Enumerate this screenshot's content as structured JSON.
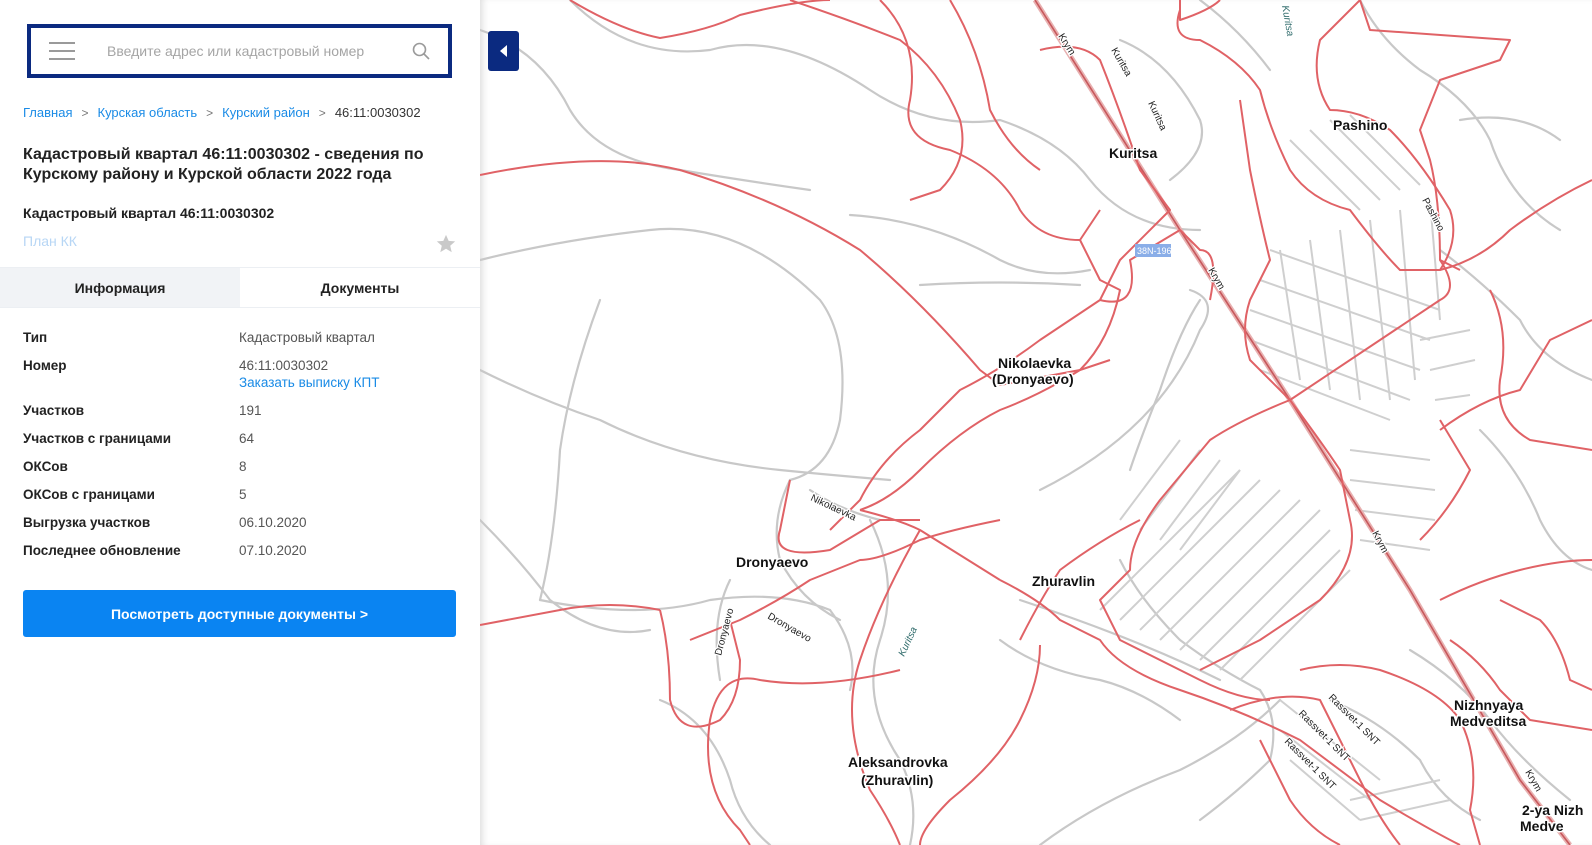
{
  "search": {
    "placeholder": "Введите адрес или кадастровый номер",
    "value": ""
  },
  "breadcrumb": {
    "items": [
      "Главная",
      "Курская область",
      "Курский район"
    ],
    "current": "46:11:0030302"
  },
  "page_title": "Кадастровый квартал 46:11:0030302 - сведения по Курскому району и Курской области 2022 года",
  "sub_title": "Кадастровый квартал 46:11:0030302",
  "plan_link": "План КК",
  "tabs": [
    "Информация",
    "Документы"
  ],
  "info": {
    "rows": [
      {
        "key": "Тип",
        "value": "Кадастровый квартал"
      },
      {
        "key": "Номер",
        "value": "46:11:0030302",
        "link": "Заказать выписку КПТ"
      },
      {
        "key": "Участков",
        "value": "191"
      },
      {
        "key": "Участков с границами",
        "value": "64"
      },
      {
        "key": "ОКСов",
        "value": "8"
      },
      {
        "key": "ОКСов с границами",
        "value": "5"
      },
      {
        "key": "Выгрузка участков",
        "value": "06.10.2020"
      },
      {
        "key": "Последнее обновление",
        "value": "07.10.2020"
      }
    ]
  },
  "docs_button": "Посмотреть доступные документы >",
  "map": {
    "places": [
      "Pashino",
      "Kuritsa",
      "Nikolaevka",
      "(Dronyaevo)",
      "Dronyaevo",
      "Zhuravlin",
      "Aleksandrovka",
      "(Zhuravlin)",
      "Nizhnyaya",
      "Medveditsa",
      "2-ya Nizh",
      "Medve"
    ],
    "streets": [
      "Krym",
      "Kuritsa",
      "Kuritsa",
      "Pashino",
      "Krym",
      "Nikolaevka",
      "Dronyaevo",
      "Dronyaevo",
      "Krym",
      "Rassvet-1 SNT",
      "Rassvet-1 SNT",
      "Rassvet-1 SNT",
      "Krym"
    ],
    "water": [
      "Kuritsa",
      "Kuritsa"
    ],
    "road_shield": "38N-196",
    "colors": {
      "parcel_border": "#e06266",
      "road": "#c8c8c8",
      "main_road": "#d98e8e",
      "accent": "#0b2a80",
      "button": "#0a84f2"
    }
  }
}
